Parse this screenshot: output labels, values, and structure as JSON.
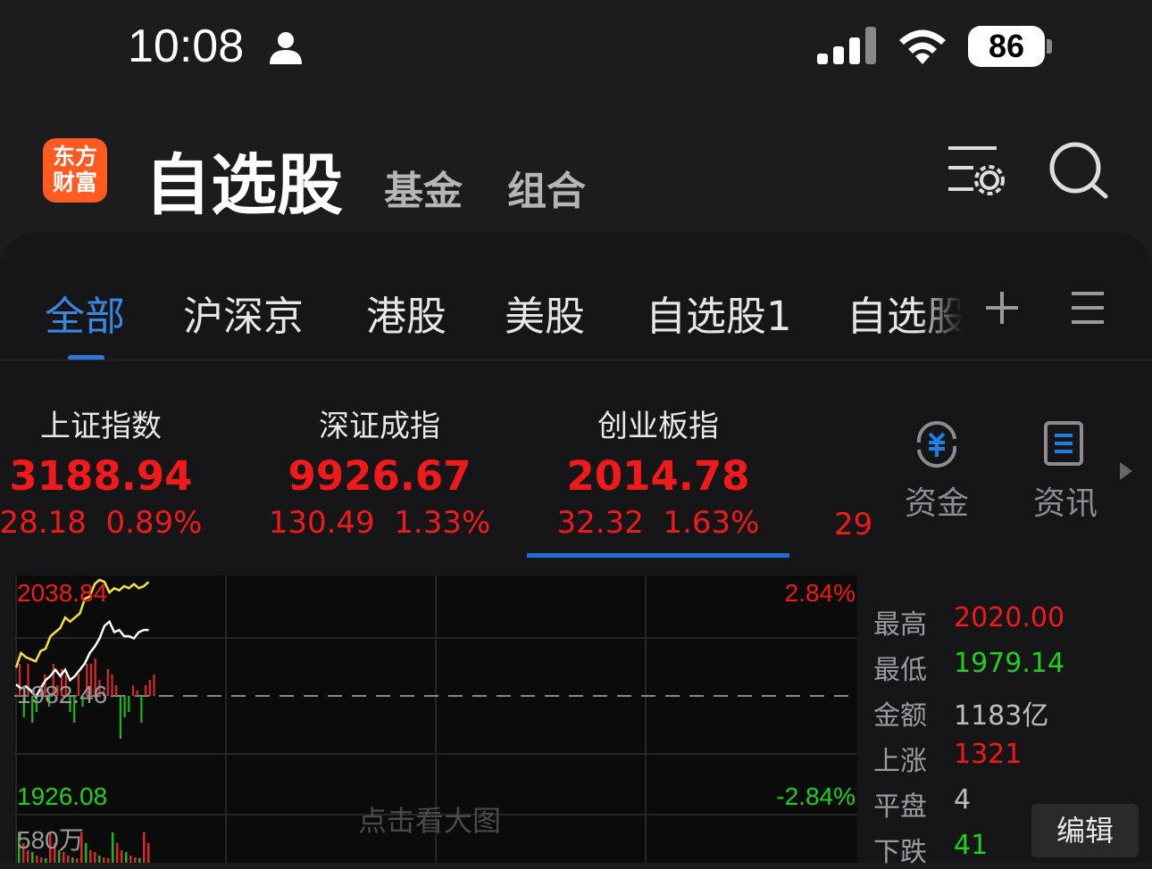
{
  "status": {
    "time": "10:08",
    "battery": "86"
  },
  "header": {
    "logo_line1": "东方",
    "logo_line2": "财富",
    "title": "自选股",
    "nav": [
      "基金",
      "组合"
    ]
  },
  "tabs": [
    {
      "label": "全部",
      "active": true
    },
    {
      "label": "沪深京"
    },
    {
      "label": "港股"
    },
    {
      "label": "美股"
    },
    {
      "label": "自选股1"
    },
    {
      "label": "自选股"
    }
  ],
  "indices": [
    {
      "name": "上证指数",
      "value": "3188.94",
      "change": "28.18",
      "pct": "0.89%"
    },
    {
      "name": "深证成指",
      "value": "9926.67",
      "change": "130.49",
      "pct": "1.33%"
    },
    {
      "name": "创业板指",
      "value": "2014.78",
      "change": "32.32",
      "pct": "1.63%"
    },
    {
      "name": "",
      "value": "",
      "change": "29",
      "pct": ""
    }
  ],
  "tools": [
    {
      "label": "资金",
      "icon": "yuan-cycle-icon"
    },
    {
      "label": "资讯",
      "icon": "document-icon"
    }
  ],
  "chart_data": {
    "type": "line",
    "y_max_label": "2038.84",
    "y_min_label": "1926.08",
    "prev_close_label": "1982.46",
    "pct_max_label": "2.84%",
    "pct_min_label": "-2.84%",
    "volume_label": "580万",
    "ylim": [
      1926.08,
      2038.84
    ],
    "prev_close": 1982.46,
    "series": [
      {
        "color": "#f5e33a",
        "values": [
          1996,
          2003,
          2001,
          2000,
          1999,
          2004,
          2005,
          2011,
          2013,
          2015,
          2020,
          2018,
          2020,
          2022,
          2029,
          2030,
          2036,
          2038,
          2037,
          2032,
          2034,
          2033,
          2035,
          2034,
          2036,
          2034,
          2035,
          2037
        ]
      },
      {
        "color": "#ffffff",
        "values": [
          1988,
          1986,
          1987,
          1985,
          1982,
          1986,
          1990,
          1992,
          1995,
          1992,
          1995,
          1990,
          1992,
          1995,
          1998,
          2003,
          2006,
          2010,
          2016,
          2018,
          2013,
          2014,
          2011,
          2011,
          2010,
          2013,
          2014,
          2014
        ]
      }
    ],
    "bars": [
      6,
      -4,
      6,
      -5,
      -3,
      2,
      4,
      -2,
      6,
      2,
      5,
      4,
      -3,
      -5,
      4,
      -2,
      6,
      6,
      7,
      3,
      1,
      5,
      4,
      2,
      -8,
      -4,
      -3,
      2,
      1,
      -5,
      2,
      3,
      4
    ]
  },
  "watermark": "点击看大图",
  "stats": [
    {
      "label": "最高",
      "value": "2020.00",
      "color": "#f01a1a"
    },
    {
      "label": "最低",
      "value": "1979.14",
      "color": "#1fd01f"
    },
    {
      "label": "金额",
      "value": "1183亿",
      "color": "#bdbdc0"
    },
    {
      "label": "上涨",
      "value": "1321",
      "color": "#f01a1a"
    },
    {
      "label": "平盘",
      "value": "4",
      "color": "#bdbdc0"
    },
    {
      "label": "下跌",
      "value": "41",
      "color": "#1fd01f"
    }
  ],
  "edit_label": "编辑"
}
